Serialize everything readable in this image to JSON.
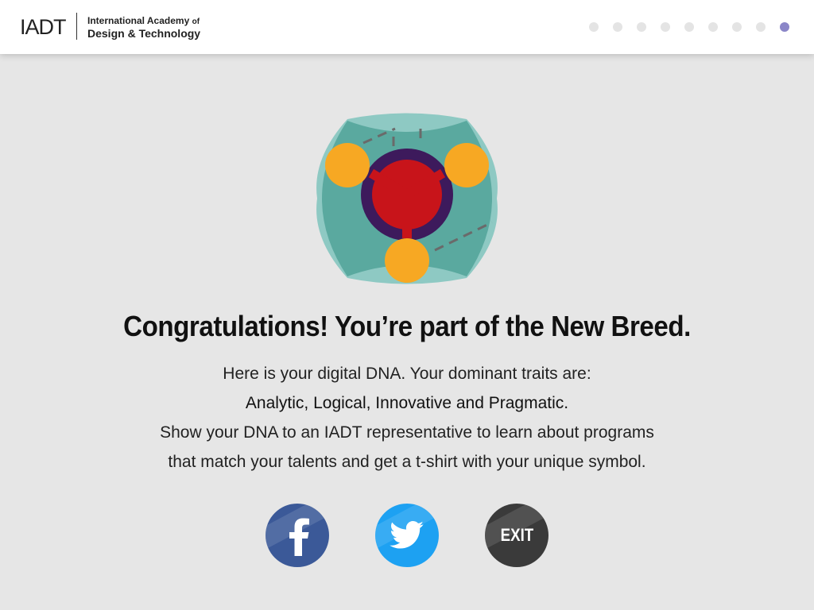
{
  "header": {
    "logo_mark": "IADT",
    "logo_line1": "International Academy",
    "logo_of": "of",
    "logo_line2": "Design & Technology",
    "steps_total": 9,
    "steps_active": 9
  },
  "symbol": {
    "colors": {
      "teal_light": "#8ec9c3",
      "teal": "#5aa99f",
      "orange": "#f7a823",
      "purple": "#3d1a5c",
      "red": "#c8141a",
      "dash": "#6a6a6a"
    }
  },
  "main": {
    "headline": "Congratulations! You’re part of the New Breed.",
    "line1": "Here is your digital DNA. Your dominant traits are:",
    "traits": "Analytic, Logical, Innovative and Pragmatic.",
    "line3": "Show your DNA to an IADT representative to learn about programs",
    "line4": "that match your talents and get a t-shirt with your unique symbol."
  },
  "share": {
    "facebook_icon": "facebook-icon",
    "twitter_icon": "twitter-icon",
    "exit_label": "EXIT",
    "colors": {
      "facebook": "#3b5998",
      "twitter": "#1da1f2",
      "exit": "#3a3a3a"
    }
  }
}
